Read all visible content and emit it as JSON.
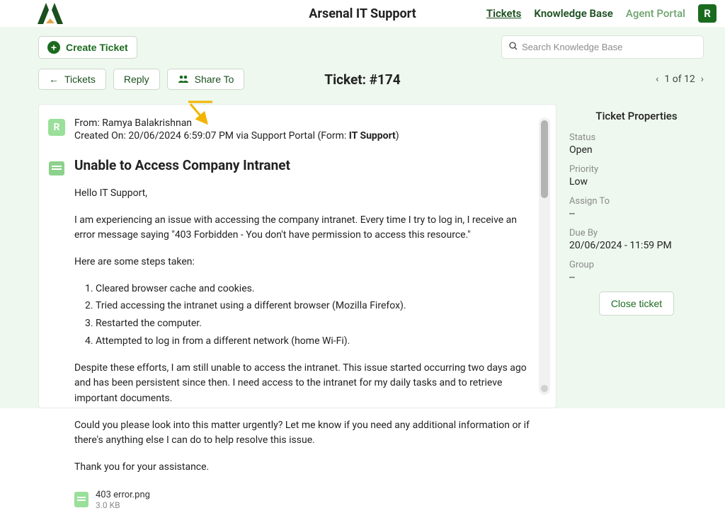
{
  "header": {
    "brand": "Arsenal IT Support",
    "nav": {
      "tickets": "Tickets",
      "kb": "Knowledge Base",
      "portal": "Agent Portal"
    },
    "avatar_initial": "R"
  },
  "toolbar": {
    "create_label": "Create Ticket",
    "search_placeholder": "Search Knowledge Base"
  },
  "ticket_bar": {
    "tickets_btn": "Tickets",
    "reply_btn": "Reply",
    "share_btn": "Share To",
    "ticket_label": "Ticket: #174",
    "pager_text": "1 of 12"
  },
  "message": {
    "from_label": "From: ",
    "from_name": "Ramya Balakrishnan",
    "created_label": "Created On: ",
    "created_val": "20/06/2024 6:59:07 PM via Support Portal (Form: ",
    "form_name": "IT Support",
    "form_close": ")",
    "subject": "Unable to Access Company Intranet",
    "body": {
      "p1": "Hello IT Support,",
      "p2": "I am experiencing an issue with accessing the company intranet. Every time I try to log in, I receive an error message saying \"403 Forbidden - You don't have permission to access this resource.\"",
      "p3": "Here are some steps taken:",
      "steps": [
        "Cleared browser cache and cookies.",
        "Tried accessing the intranet using a different browser (Mozilla Firefox).",
        "Restarted the computer.",
        "Attempted to log in from a different network (home Wi-Fi)."
      ],
      "p4": "Despite these efforts, I am still unable to access the intranet. This issue started occurring two days ago and has been persistent since then. I need access to the intranet for my daily tasks and to retrieve important documents.",
      "p5": "Could you please look into this matter urgently? Let me know if you need any additional information or if there's anything else I can do to help resolve this issue.",
      "p6": "Thank you for your assistance."
    },
    "attachment": {
      "name": "403 error.png",
      "size": "3.0 KB"
    },
    "user_initial": "R"
  },
  "sidebar": {
    "title": "Ticket Properties",
    "status_label": "Status",
    "status_val": "Open",
    "priority_label": "Priority",
    "priority_val": "Low",
    "assign_label": "Assign To",
    "assign_val": "--",
    "due_label": "Due By",
    "due_val": "20/06/2024 - 11:59 PM",
    "group_label": "Group",
    "group_val": "--",
    "close_btn": "Close ticket"
  }
}
